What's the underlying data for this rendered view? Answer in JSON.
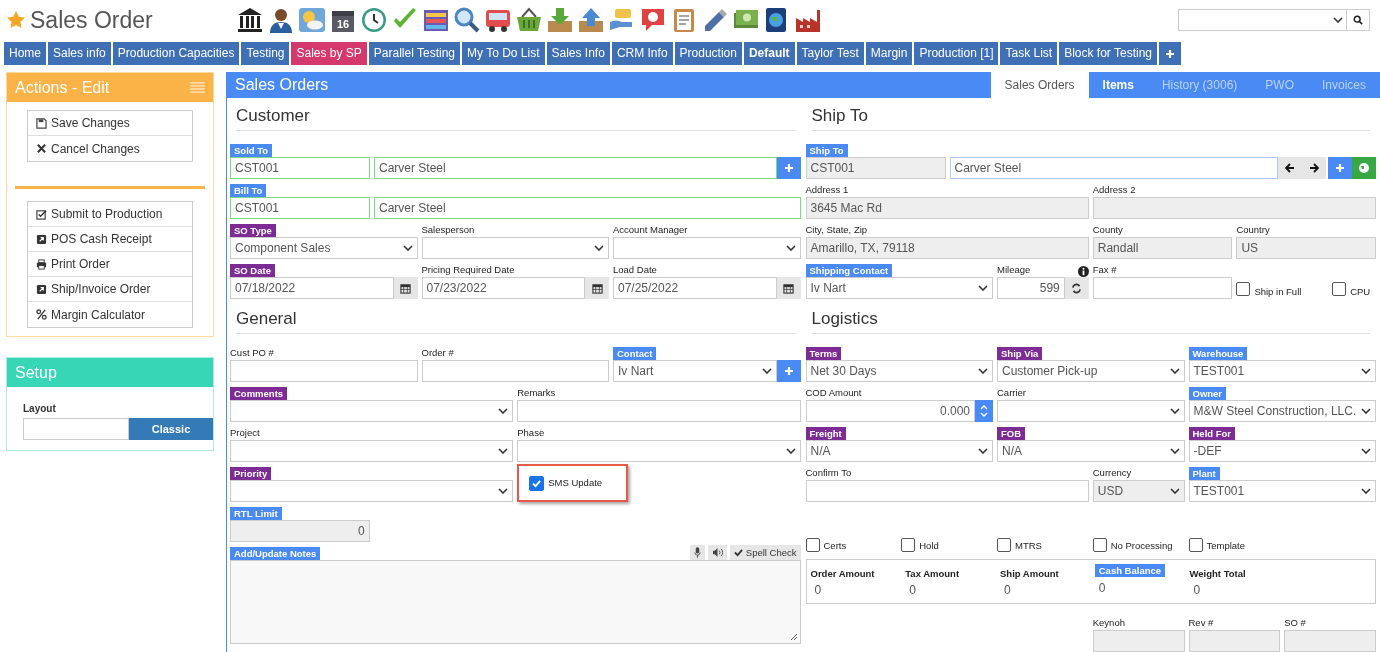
{
  "header": {
    "title": "Sales Order",
    "favorite": true,
    "calendar_day": "16"
  },
  "nav_tabs": [
    {
      "label": "Home",
      "color": "#3f6fb5",
      "selected": false
    },
    {
      "label": "Sales info",
      "color": "#3f6fb5",
      "selected": false
    },
    {
      "label": "Production Capacities",
      "color": "#3f6fb5",
      "selected": false
    },
    {
      "label": "Testing",
      "color": "#3f6fb5",
      "selected": false
    },
    {
      "label": "Sales by SP",
      "color": "#d4386d",
      "selected": false
    },
    {
      "label": "Parallel Testing",
      "color": "#3f6fb5",
      "selected": false
    },
    {
      "label": "My To Do List",
      "color": "#3f6fb5",
      "selected": false
    },
    {
      "label": "Sales Info",
      "color": "#3f6fb5",
      "selected": false
    },
    {
      "label": "CRM Info",
      "color": "#3f6fb5",
      "selected": false
    },
    {
      "label": "Production",
      "color": "#3f6fb5",
      "selected": false
    },
    {
      "label": "Default",
      "color": "#3f6fb5",
      "selected": true
    },
    {
      "label": "Taylor Test",
      "color": "#3f6fb5",
      "selected": false
    },
    {
      "label": "Margin",
      "color": "#3f6fb5",
      "selected": false
    },
    {
      "label": "Production [1]",
      "color": "#3f6fb5",
      "selected": false
    },
    {
      "label": "Task List",
      "color": "#3f6fb5",
      "selected": false
    },
    {
      "label": "Block for Testing",
      "color": "#3f6fb5",
      "selected": false
    }
  ],
  "actions_panel": {
    "title": "Actions - Edit",
    "groups": [
      [
        {
          "label": "Save Changes",
          "kind": "save"
        },
        {
          "label": "Cancel Changes",
          "kind": "cancel"
        }
      ],
      [
        {
          "label": "Submit to Production",
          "kind": "submit"
        },
        {
          "label": "POS Cash Receipt",
          "kind": "external"
        },
        {
          "label": "Print Order",
          "kind": "print"
        },
        {
          "label": "Ship/Invoice Order",
          "kind": "external"
        },
        {
          "label": "Margin Calculator",
          "kind": "percent"
        }
      ]
    ]
  },
  "setup_panel": {
    "title": "Setup",
    "layout_label": "Layout",
    "layout_option": "Classic"
  },
  "main": {
    "title": "Sales Orders",
    "tabs": [
      {
        "label": "Sales Orders",
        "selected": true,
        "disabled": false
      },
      {
        "label": "Items",
        "selected": false,
        "disabled": false
      },
      {
        "label": "History (3006)",
        "selected": false,
        "disabled": true
      },
      {
        "label": "PWO",
        "selected": false,
        "disabled": true
      },
      {
        "label": "Invoices",
        "selected": false,
        "disabled": true
      }
    ]
  },
  "sections": [
    {
      "title": "Customer",
      "fields": [
        {
          "label": "Sold To",
          "color": "#4a8af4",
          "kind": "pair",
          "value": "CST001",
          "value2": "Carver Steel",
          "valid": true,
          "add_button": true
        },
        {
          "label": "Bill To",
          "color": "#4a8af4",
          "kind": "pair",
          "value": "CST001",
          "value2": "Carver Steel",
          "valid": true
        },
        {
          "label": "SO Type",
          "color": "#7d2c95",
          "kind": "select",
          "value": "Component Sales"
        },
        {
          "label": "Salesperson",
          "kind": "select"
        },
        {
          "label": "Account Manager",
          "kind": "select"
        },
        {
          "label": "SO Date",
          "color": "#7d2c95",
          "kind": "date",
          "value": "07/18/2022"
        },
        {
          "label": "Pricing Required Date",
          "kind": "date",
          "value": "07/23/2022"
        },
        {
          "label": "Load Date",
          "kind": "date",
          "value": "07/25/2022"
        }
      ]
    },
    {
      "title": "Ship To",
      "fields": [
        {
          "label": "Ship To",
          "color": "#4a8af4",
          "kind": "pair",
          "value": "CST001",
          "value2": "Carver Steel",
          "readonly": true,
          "focused": true,
          "nav_buttons": true,
          "add_button": true,
          "globe_button": true
        },
        {
          "label": "Address 1",
          "kind": "text",
          "value": "3645 Mac Rd",
          "readonly": true
        },
        {
          "label": "Address 2",
          "kind": "text",
          "readonly": true
        },
        {
          "label": "City, State, Zip",
          "kind": "text",
          "value": "Amarillo, TX, 79118",
          "readonly": true
        },
        {
          "label": "County",
          "kind": "text",
          "value": "Randall",
          "readonly": true
        },
        {
          "label": "Country",
          "kind": "text",
          "value": "US",
          "readonly": true
        },
        {
          "label": "Shipping Contact",
          "color": "#4a8af4",
          "kind": "select",
          "value": "Iv Nart"
        },
        {
          "label": "Mileage",
          "kind": "number",
          "value": "599",
          "info": true,
          "refresh_button": true
        },
        {
          "label": "Fax #",
          "kind": "text"
        },
        {
          "label": "Ship in Full",
          "kind": "check",
          "checked": false
        },
        {
          "label": "CPU",
          "kind": "check",
          "checked": false
        }
      ]
    },
    {
      "title": "General",
      "fields": [
        {
          "label": "Cust PO #",
          "kind": "text"
        },
        {
          "label": "Order #",
          "kind": "text"
        },
        {
          "label": "Contact",
          "color": "#4a8af4",
          "kind": "select",
          "value": "Iv Nart",
          "add_button": true
        },
        {
          "label": "Comments",
          "color": "#7d2c95",
          "kind": "select"
        },
        {
          "label": "Remarks",
          "kind": "text"
        },
        {
          "label": "Project",
          "kind": "select"
        },
        {
          "label": "Phase",
          "kind": "select"
        },
        {
          "label": "Priority",
          "color": "#7d2c95",
          "kind": "select"
        },
        {
          "label": "SMS Update",
          "kind": "check",
          "checked": true,
          "highlighted": true
        },
        {
          "label": "RTL Limit",
          "color": "#4a8af4",
          "kind": "number",
          "value": "0",
          "readonly": true
        },
        {
          "label": "Add/Update Notes",
          "color": "#4a8af4",
          "kind": "textarea",
          "spell_check": "Spell Check"
        }
      ]
    },
    {
      "title": "Logistics",
      "fields": [
        {
          "label": "Terms",
          "color": "#7d2c95",
          "kind": "select",
          "value": "Net 30 Days"
        },
        {
          "label": "Ship Via",
          "color": "#7d2c95",
          "kind": "select",
          "value": "Customer Pick-up"
        },
        {
          "label": "Warehouse",
          "color": "#4a8af4",
          "kind": "select",
          "value": "TEST001"
        },
        {
          "label": "COD Amount",
          "kind": "number",
          "value": "0.000",
          "spinner": true
        },
        {
          "label": "Carrier",
          "kind": "select"
        },
        {
          "label": "Owner",
          "color": "#4a8af4",
          "kind": "select",
          "value": "M&W Steel Construction, LLC."
        },
        {
          "label": "Freight",
          "color": "#7d2c95",
          "kind": "select",
          "value": "N/A"
        },
        {
          "label": "FOB",
          "color": "#7d2c95",
          "kind": "select",
          "value": "N/A"
        },
        {
          "label": "Held For",
          "color": "#7d2c95",
          "kind": "select",
          "value": "-DEF"
        },
        {
          "label": "Confirm To",
          "kind": "text"
        },
        {
          "label": "Currency",
          "kind": "select",
          "value": "USD",
          "readonly": true
        },
        {
          "label": "Plant",
          "color": "#4a8af4",
          "kind": "select",
          "value": "TEST001"
        }
      ],
      "checkboxes": [
        {
          "label": "Certs",
          "checked": false
        },
        {
          "label": "Hold",
          "checked": false
        },
        {
          "label": "MTRS",
          "checked": false
        },
        {
          "label": "No Processing",
          "checked": false
        },
        {
          "label": "Template",
          "checked": false
        }
      ],
      "summary": [
        {
          "label": "Order Amount",
          "value": "0"
        },
        {
          "label": "Tax Amount",
          "value": "0"
        },
        {
          "label": "Ship Amount",
          "value": "0"
        },
        {
          "label": "Cash Balance",
          "color": "#4a8af4",
          "value": "0"
        },
        {
          "label": "Weight Total",
          "value": "0"
        }
      ],
      "reference_fields": [
        {
          "label": "Keynoh",
          "readonly": true
        },
        {
          "label": "Rev #",
          "readonly": true
        },
        {
          "label": "SO #",
          "readonly": true
        }
      ]
    }
  ]
}
